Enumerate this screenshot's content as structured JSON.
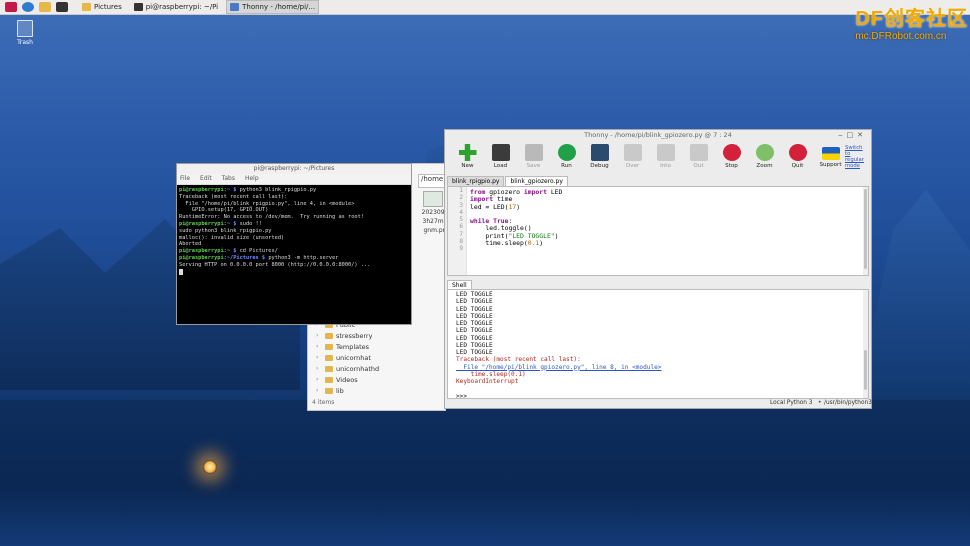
{
  "taskbar": {
    "tasks": [
      {
        "label": "Pictures",
        "icon": "folder-icon"
      },
      {
        "label": "pi@raspberrypi: ~/Pi",
        "icon": "terminal-icon"
      },
      {
        "label": "Thonny - /home/pi/...",
        "icon": "thonny-icon"
      }
    ]
  },
  "watermark": {
    "big": "DF创客社区",
    "small": "mc.DFRobot.com.cn"
  },
  "desktop": {
    "trash_label": "Trash"
  },
  "file_manager": {
    "path": "/home",
    "thumb_caption": [
      "2023092",
      "3h27m5",
      "gnm.pn"
    ],
    "tree": [
      "Public",
      "stressberry",
      "Templates",
      "unicornhat",
      "unicornhathd",
      "Videos",
      "lib"
    ],
    "status": "4 items"
  },
  "terminal": {
    "title": "pi@raspberrypi: ~/Pictures",
    "menu": [
      "File",
      "Edit",
      "Tabs",
      "Help"
    ],
    "lines": [
      {
        "prompt": "pi@raspberrypi",
        "dir": ":~ $",
        "text": " python3 blink_rpigpio.py"
      },
      {
        "text": "Traceback (most recent call last):"
      },
      {
        "text": "  File \"/home/pi/blink_rpigpio.py\", line 4, in <module>"
      },
      {
        "text": "    GPIO.setup(17, GPIO.OUT)"
      },
      {
        "text": "RuntimeError: No access to /dev/mem.  Try running as root!"
      },
      {
        "prompt": "pi@raspberrypi",
        "dir": ":~ $",
        "text": " sudo !!"
      },
      {
        "text": "sudo python3 blink_rpigpio.py"
      },
      {
        "text": "malloc(): invalid size (unsorted)"
      },
      {
        "text": "Aborted"
      },
      {
        "prompt": "pi@raspberrypi",
        "dir": ":~ $",
        "text": " cd Pictures/"
      },
      {
        "prompt": "pi@raspberrypi",
        "dir": ":~/Pictures $",
        "text": " python3 -m http.server"
      },
      {
        "text": "Serving HTTP on 0.0.0.0 port 8000 (http://0.0.0.0:8000/) ..."
      }
    ]
  },
  "thonny": {
    "title": "Thonny - /home/pi/blink_gpiozero.py @ 7 : 24",
    "toolbar": [
      {
        "label": "New",
        "icon": "new-file-icon",
        "enabled": true,
        "color": "#2fa12f"
      },
      {
        "label": "Load",
        "icon": "load-icon",
        "enabled": true,
        "color": "#3b3b3b"
      },
      {
        "label": "Save",
        "icon": "save-icon",
        "enabled": false,
        "color": "#b9b9b9"
      },
      {
        "label": "Run",
        "icon": "run-icon",
        "enabled": true,
        "color": "#21a04a"
      },
      {
        "label": "Debug",
        "icon": "debug-icon",
        "enabled": true,
        "color": "#2c4a6e"
      },
      {
        "label": "Over",
        "icon": "step-over-icon",
        "enabled": false,
        "color": "#c9c9c9"
      },
      {
        "label": "Into",
        "icon": "step-into-icon",
        "enabled": false,
        "color": "#c9c9c9"
      },
      {
        "label": "Out",
        "icon": "step-out-icon",
        "enabled": false,
        "color": "#c9c9c9"
      },
      {
        "label": "Stop",
        "icon": "stop-icon",
        "enabled": true,
        "color": "#d3203b"
      },
      {
        "label": "Zoom",
        "icon": "zoom-icon",
        "enabled": true,
        "color": "#7fbf6a"
      },
      {
        "label": "Quit",
        "icon": "quit-icon",
        "enabled": true,
        "color": "#d3203b"
      },
      {
        "label": "Support",
        "icon": "ukraine-flag-icon",
        "enabled": true,
        "color": "#f7d300"
      }
    ],
    "support_link": "Switch to regular mode",
    "tabs": [
      "blink_rpigpio.py",
      "blink_gpiozero.py"
    ],
    "line_numbers": [
      "1",
      "2",
      "3",
      "4",
      "5",
      "6",
      "7",
      "8",
      "9"
    ],
    "code": [
      [
        {
          "t": "from",
          "c": "kw"
        },
        {
          "t": " gpiozero ",
          "c": ""
        },
        {
          "t": "import",
          "c": "kw"
        },
        {
          "t": " LED",
          "c": ""
        }
      ],
      [
        {
          "t": "import",
          "c": "kw"
        },
        {
          "t": " time",
          "c": ""
        }
      ],
      [
        {
          "t": "led = LED(",
          "c": ""
        },
        {
          "t": "17",
          "c": "num"
        },
        {
          "t": ")",
          "c": ""
        }
      ],
      [],
      [
        {
          "t": "while",
          "c": "kw"
        },
        {
          "t": " ",
          "c": ""
        },
        {
          "t": "True",
          "c": "kw"
        },
        {
          "t": ":",
          "c": ""
        }
      ],
      [
        {
          "t": "    led.toggle()",
          "c": ""
        }
      ],
      [
        {
          "t": "    print(",
          "c": ""
        },
        {
          "t": "\"LED TOGGLE\"",
          "c": "str"
        },
        {
          "t": ")",
          "c": ""
        }
      ],
      [
        {
          "t": "    time.sleep(",
          "c": ""
        },
        {
          "t": "0.1",
          "c": "num"
        },
        {
          "t": ")",
          "c": ""
        }
      ],
      []
    ],
    "shell_tab": "Shell",
    "shell_lines": [
      {
        "t": "LED TOGGLE",
        "c": ""
      },
      {
        "t": "LED TOGGLE",
        "c": ""
      },
      {
        "t": "LED TOGGLE",
        "c": ""
      },
      {
        "t": "LED TOGGLE",
        "c": ""
      },
      {
        "t": "LED TOGGLE",
        "c": ""
      },
      {
        "t": "LED TOGGLE",
        "c": ""
      },
      {
        "t": "LED TOGGLE",
        "c": ""
      },
      {
        "t": "LED TOGGLE",
        "c": ""
      },
      {
        "t": "LED TOGGLE",
        "c": ""
      },
      {
        "t": "Traceback (most recent call last):",
        "c": "err"
      },
      {
        "t": "  File \"/home/pi/blink_gpiozero.py\", line 8, in <module>",
        "c": "lnk"
      },
      {
        "t": "    time.sleep(0.1)",
        "c": "err"
      },
      {
        "t": "KeyboardInterrupt",
        "c": "err"
      },
      {
        "t": "",
        "c": ""
      },
      {
        "t": ">>> ",
        "c": ""
      }
    ],
    "status_interpreter": "Local Python 3",
    "status_path": "/usr/bin/python3"
  }
}
